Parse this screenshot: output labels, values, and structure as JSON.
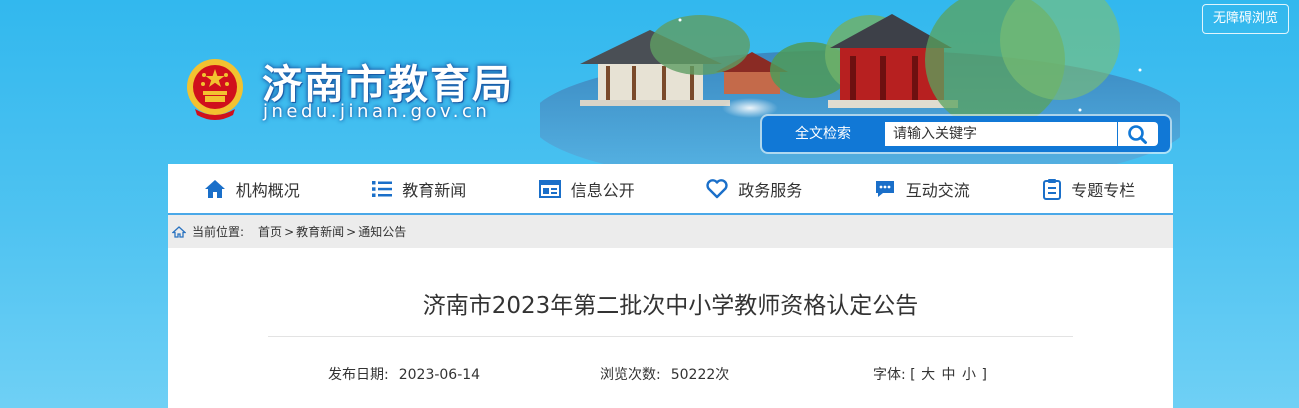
{
  "header": {
    "accessibility_label": "无障碍浏览",
    "site_title": "济南市教育局",
    "site_domain": "jnedu.jinan.gov.cn",
    "search": {
      "label": "全文检索",
      "placeholder": "请输入关键字"
    }
  },
  "nav": {
    "items": [
      {
        "label": "机构概况",
        "icon": "home-icon"
      },
      {
        "label": "教育新闻",
        "icon": "list-icon"
      },
      {
        "label": "信息公开",
        "icon": "window-icon"
      },
      {
        "label": "政务服务",
        "icon": "heart-icon"
      },
      {
        "label": "互动交流",
        "icon": "chat-icon"
      },
      {
        "label": "专题专栏",
        "icon": "clipboard-icon"
      }
    ]
  },
  "breadcrumb": {
    "label": "当前位置:",
    "items": [
      "首页",
      "教育新闻",
      "通知公告"
    ],
    "separator": ">"
  },
  "article": {
    "title": "济南市2023年第二批次中小学教师资格认定公告",
    "date_label": "发布日期:",
    "date": "2023-06-14",
    "views_label": "浏览次数:",
    "views": "50222次",
    "fontsize_label": "字体:",
    "fontsize_open": "[",
    "fontsize_options": [
      "大",
      "中",
      "小"
    ],
    "fontsize_close": "]"
  },
  "colors": {
    "background": "#32b8ee",
    "nav_icon": "#1a6fc9",
    "search_bar": "#1178d6",
    "emblem_red": "#d0101c",
    "emblem_gold": "#f2c230"
  }
}
